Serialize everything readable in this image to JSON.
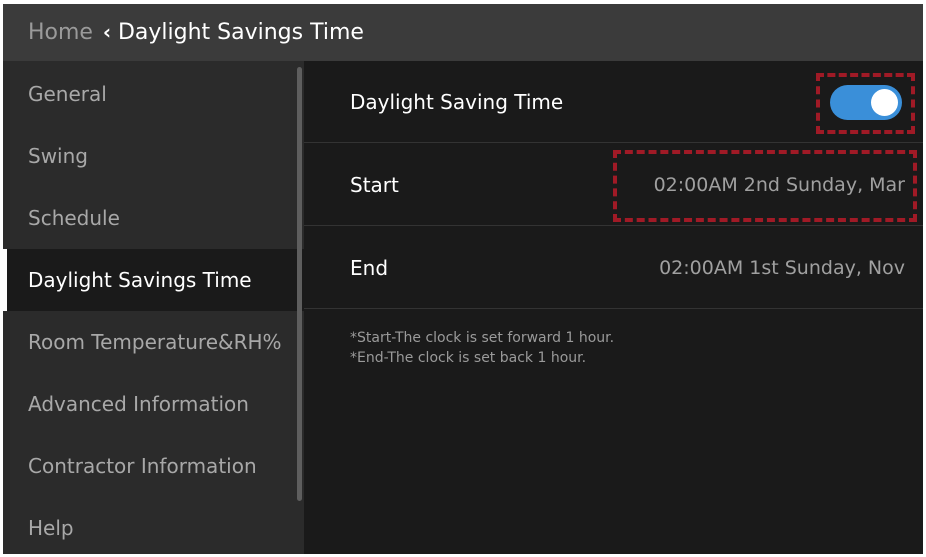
{
  "header": {
    "home_label": "Home",
    "title": "Daylight Savings Time"
  },
  "sidebar": {
    "items": [
      {
        "label": "General"
      },
      {
        "label": "Swing"
      },
      {
        "label": "Schedule"
      },
      {
        "label": "Daylight Savings Time",
        "active": true
      },
      {
        "label": "Room Temperature&RH%"
      },
      {
        "label": "Advanced Information"
      },
      {
        "label": "Contractor Information"
      },
      {
        "label": "Help"
      }
    ]
  },
  "main": {
    "dst": {
      "label": "Daylight Saving Time",
      "enabled": true
    },
    "start": {
      "label": "Start",
      "value": "02:00AM 2nd Sunday, Mar"
    },
    "end": {
      "label": "End",
      "value": "02:00AM 1st Sunday, Nov"
    },
    "notes": [
      "*Start-The clock is set forward 1 hour.",
      "*End-The clock is set back 1 hour."
    ]
  },
  "colors": {
    "accent": "#3a8fd9",
    "highlight": "#a01a26"
  }
}
